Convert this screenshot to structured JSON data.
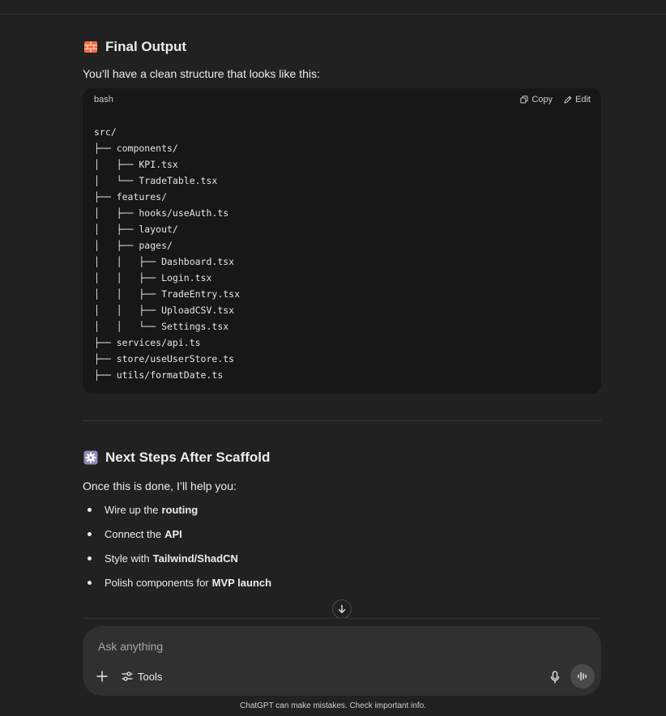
{
  "section1": {
    "title": "Final Output",
    "icon": "brick-icon",
    "intro": "You’ll have a clean structure that looks like this:"
  },
  "code_block": {
    "language": "bash",
    "copy_label": "Copy",
    "edit_label": "Edit",
    "code": "src/\n├── components/\n│   ├── KPI.tsx\n│   └── TradeTable.tsx\n├── features/\n│   ├── hooks/useAuth.ts\n│   ├── layout/\n│   ├── pages/\n│   │   ├── Dashboard.tsx\n│   │   ├── Login.tsx\n│   │   ├── TradeEntry.tsx\n│   │   ├── UploadCSV.tsx\n│   │   └── Settings.tsx\n├── services/api.ts\n├── store/useUserStore.ts\n├── utils/formatDate.ts"
  },
  "section2": {
    "title": "Next Steps After Scaffold",
    "icon": "gear-icon",
    "intro": "Once this is done, I’ll help you:",
    "items": [
      {
        "text": "Wire up the",
        "bold": "routing"
      },
      {
        "text": "Connect the",
        "bold": "API"
      },
      {
        "text": "Style with",
        "bold": "Tailwind/ShadCN"
      },
      {
        "text": "Polish components for",
        "bold": "MVP launch"
      }
    ]
  },
  "composer": {
    "placeholder": "Ask anything",
    "tools_label": "Tools"
  },
  "footer": {
    "note": "ChatGPT can make mistakes. Check important info."
  },
  "colors": {
    "background": "#212121",
    "code_background": "#171717",
    "composer_background": "#303030",
    "text": "#ececec"
  }
}
